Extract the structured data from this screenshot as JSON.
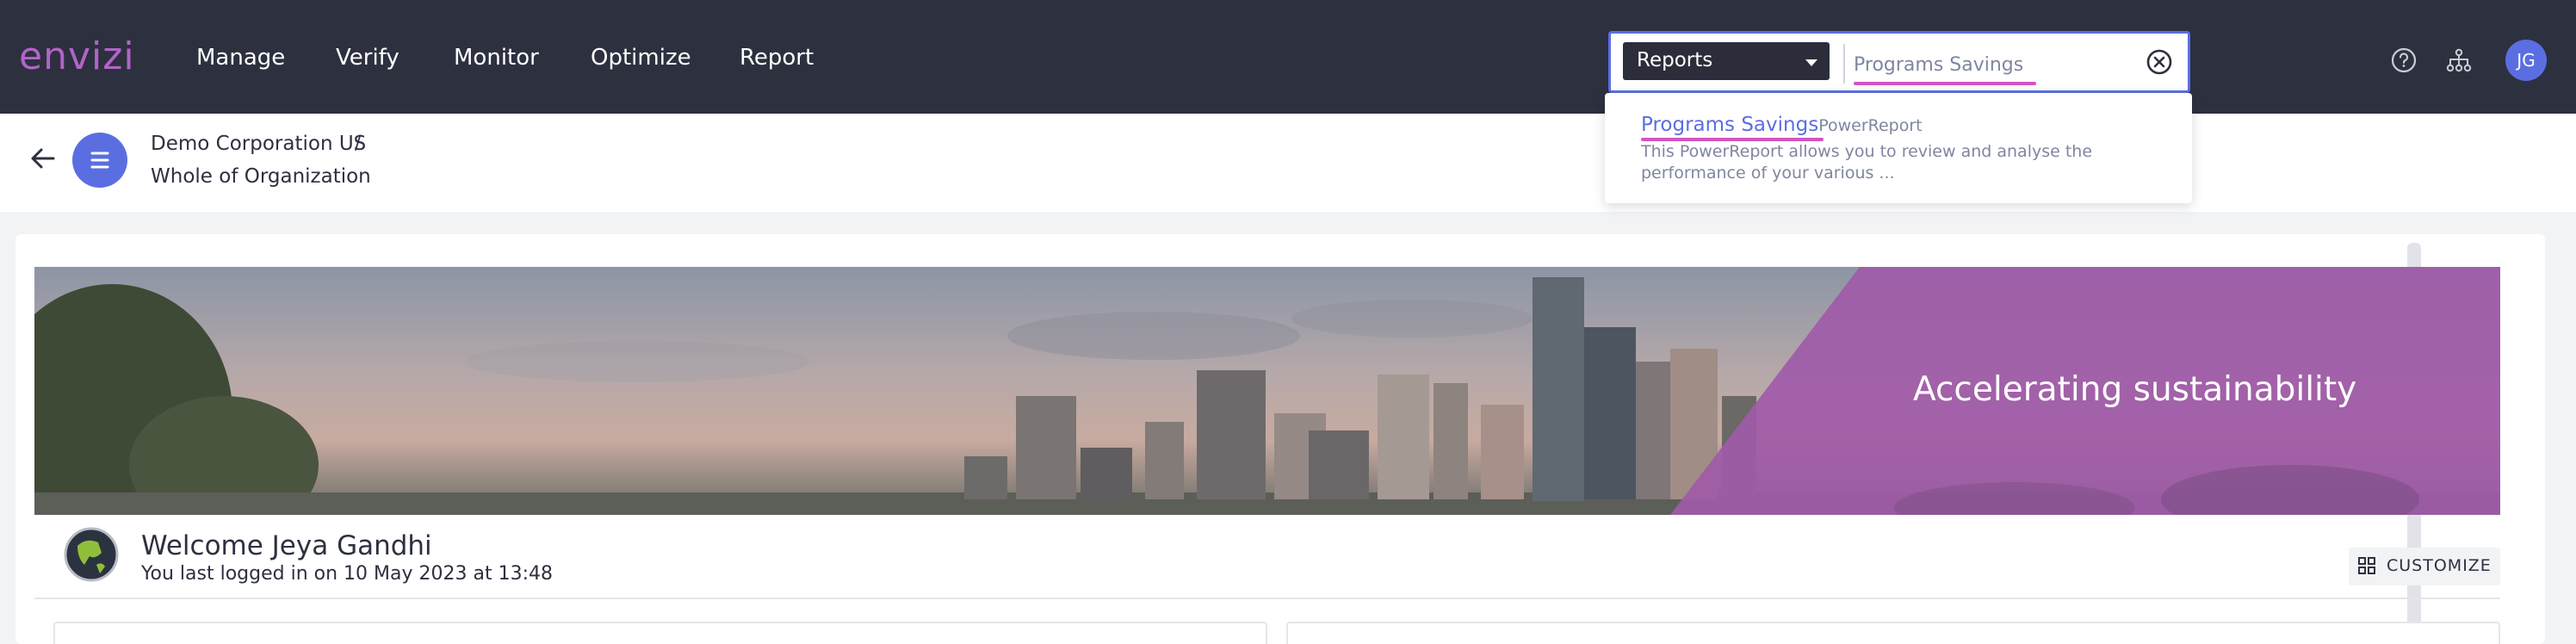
{
  "app": {
    "logo_text": "envizi"
  },
  "nav": {
    "items": [
      "Manage",
      "Verify",
      "Monitor",
      "Optimize",
      "Report"
    ]
  },
  "search": {
    "scope_selected": "Reports",
    "query": "Programs Savings"
  },
  "avatar": {
    "initials": "JG"
  },
  "breadcrumb": {
    "organization": "Demo Corporation US",
    "separator": "/",
    "scope": "Whole of Organization"
  },
  "search_results": [
    {
      "title": "Programs Savings",
      "type": "PowerReport",
      "description": "This PowerReport allows you to review and analyse the performance of your various ..."
    }
  ],
  "banner": {
    "text": "Accelerating sustainability"
  },
  "welcome": {
    "title": "Welcome Jeya Gandhi",
    "subtitle": "You last logged in on 10 May 2023 at 13:48"
  },
  "customize": {
    "label": "CUSTOMIZE"
  },
  "colors": {
    "nav_bg": "#2d303f",
    "accent_blue": "#5b6ee1",
    "accent_purple": "#b264c9",
    "highlight_pink": "#d254c4"
  },
  "icons": {
    "clear": "close-circle-icon",
    "help": "help-circle-icon",
    "hierarchy": "hierarchy-icon",
    "back": "back-arrow-icon",
    "menu": "menu-icon",
    "customize": "grid-icon",
    "globe": "globe-icon",
    "dropdown": "chevron-down-icon"
  }
}
